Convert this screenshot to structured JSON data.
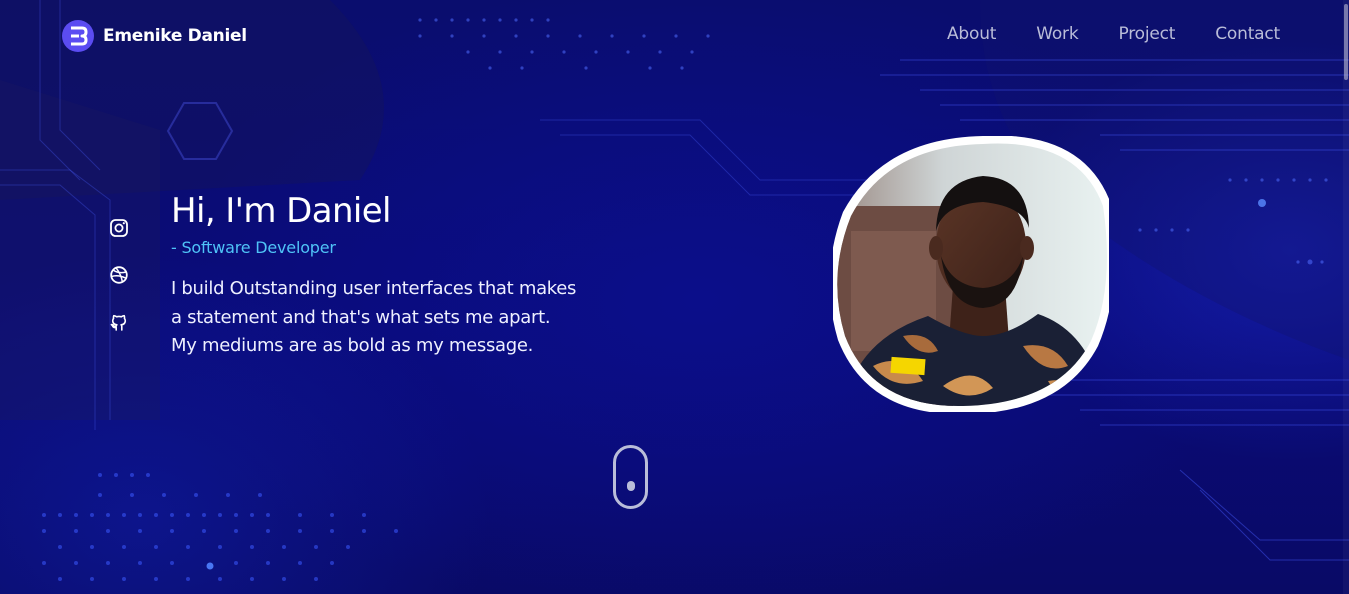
{
  "header": {
    "brand_name": "Emenike Daniel",
    "logo_icon": "e-monogram-logo-icon",
    "nav": [
      {
        "label": "About"
      },
      {
        "label": "Work"
      },
      {
        "label": "Project"
      },
      {
        "label": "Contact"
      }
    ]
  },
  "social": [
    {
      "icon": "instagram-icon"
    },
    {
      "icon": "dribbble-icon"
    },
    {
      "icon": "github-icon"
    }
  ],
  "hero": {
    "greeting": "Hi, I'm Daniel",
    "role": "- Software Developer",
    "bio_lines": [
      "I build Outstanding user interfaces that makes",
      "a statement and that's what sets me apart.",
      "My mediums are as bold as my message."
    ]
  },
  "colors": {
    "background": "#0a0d78",
    "accent": "#4fc3f7",
    "logo": "#5b4cf2",
    "nav_text": "#b9bcd8"
  }
}
